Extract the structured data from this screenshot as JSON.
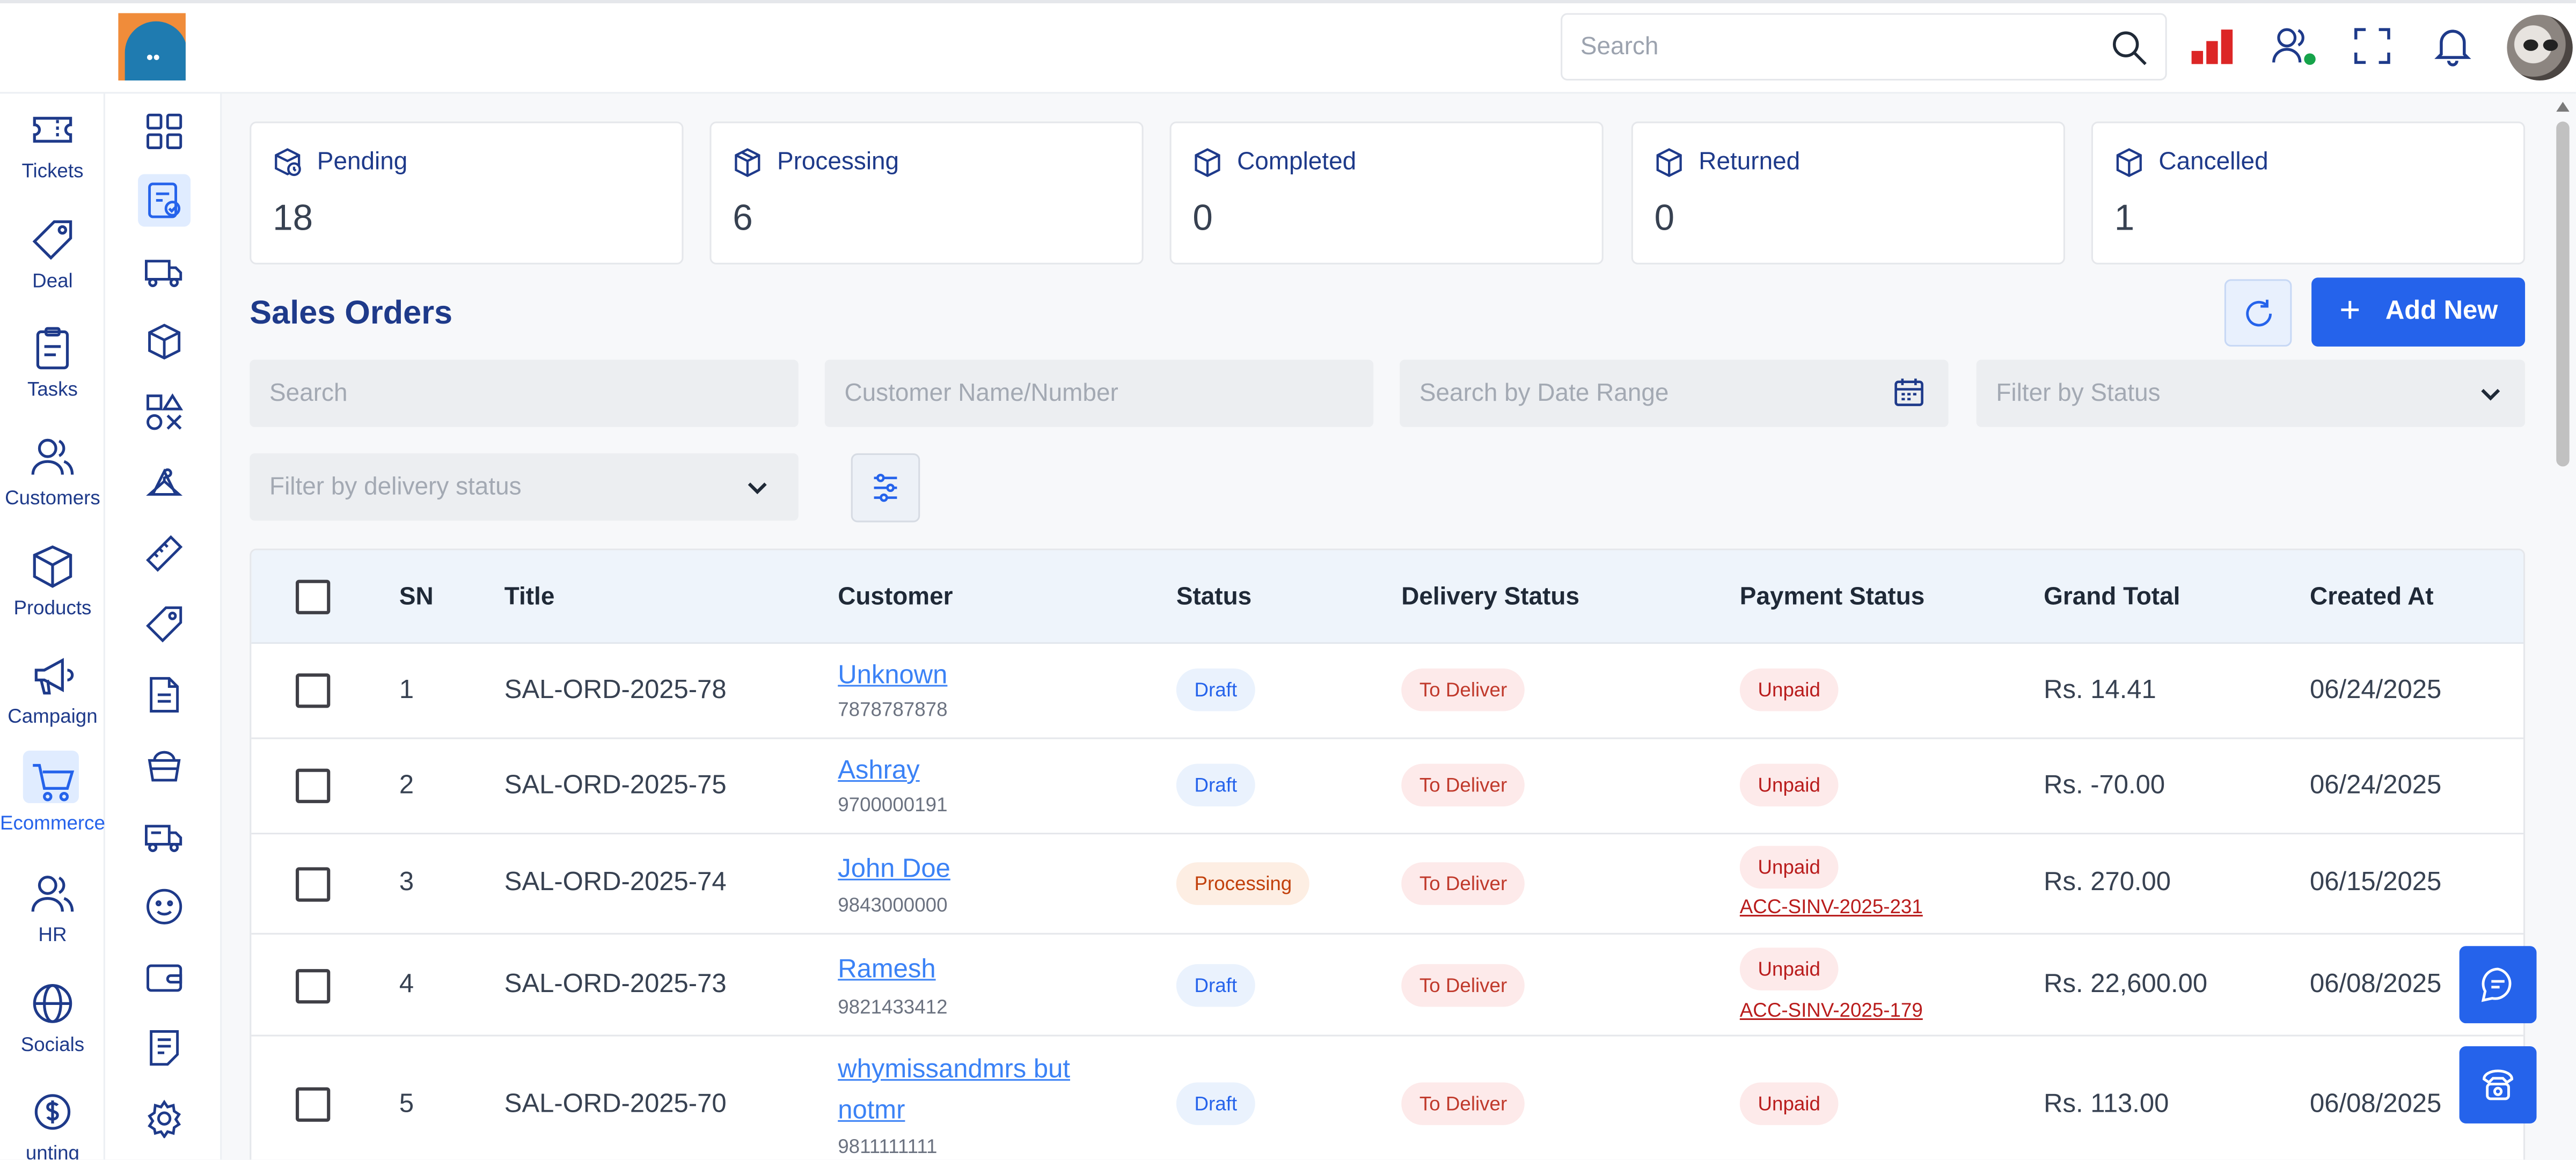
{
  "topbar": {
    "search_placeholder": "Search"
  },
  "sidebar": {
    "items": [
      {
        "label": "Tickets",
        "icon": "ticket-icon"
      },
      {
        "label": "Deal",
        "icon": "tag-icon"
      },
      {
        "label": "Tasks",
        "icon": "clipboard-icon"
      },
      {
        "label": "Customers",
        "icon": "users-icon"
      },
      {
        "label": "Products",
        "icon": "box-icon"
      },
      {
        "label": "Campaign",
        "icon": "megaphone-icon"
      },
      {
        "label": "Ecommerce",
        "icon": "cart-icon",
        "active": true
      },
      {
        "label": "HR",
        "icon": "people-icon"
      },
      {
        "label": "Socials",
        "icon": "globe-icon"
      },
      {
        "label": "unting",
        "icon": "dollar-icon"
      }
    ]
  },
  "subbar": {
    "icons": [
      "dashboard-grid-icon",
      "order-check-icon",
      "truck-icon",
      "cube-icon",
      "shapes-icon",
      "hanger-icon",
      "ruler-icon",
      "tag-icon",
      "document-icon",
      "basket-icon",
      "delivery-truck-icon",
      "smiley-icon",
      "wallet-icon",
      "note-icon",
      "settings-gear-icon"
    ],
    "active_index": 1
  },
  "stats": [
    {
      "label": "Pending",
      "value": "18"
    },
    {
      "label": "Processing",
      "value": "6"
    },
    {
      "label": "Completed",
      "value": "0"
    },
    {
      "label": "Returned",
      "value": "0"
    },
    {
      "label": "Cancelled",
      "value": "1"
    }
  ],
  "section": {
    "title": "Sales Orders",
    "add_label": "Add New"
  },
  "filters": {
    "search_placeholder": "Search",
    "customer_placeholder": "Customer Name/Number",
    "date_placeholder": "Search by Date Range",
    "status_placeholder": "Filter by Status",
    "delivery_placeholder": "Filter by delivery status"
  },
  "table": {
    "columns": [
      "SN",
      "Title",
      "Customer",
      "Status",
      "Delivery Status",
      "Payment Status",
      "Grand Total",
      "Created At"
    ],
    "rows": [
      {
        "sn": "1",
        "title": "SAL-ORD-2025-78",
        "customer": "Unknown",
        "phone": "7878787878",
        "status": "Draft",
        "delivery": "To Deliver",
        "payment": "Unpaid",
        "invoice": "",
        "total": "Rs. 14.41",
        "created": "06/24/2025"
      },
      {
        "sn": "2",
        "title": "SAL-ORD-2025-75",
        "customer": "Ashray",
        "phone": "9700000191",
        "status": "Draft",
        "delivery": "To Deliver",
        "payment": "Unpaid",
        "invoice": "",
        "total": "Rs. -70.00",
        "created": "06/24/2025"
      },
      {
        "sn": "3",
        "title": "SAL-ORD-2025-74",
        "customer": "John Doe",
        "phone": "9843000000",
        "status": "Processing",
        "delivery": "To Deliver",
        "payment": "Unpaid",
        "invoice": "ACC-SINV-2025-231",
        "total": "Rs. 270.00",
        "created": "06/15/2025"
      },
      {
        "sn": "4",
        "title": "SAL-ORD-2025-73",
        "customer": "Ramesh",
        "phone": "9821433412",
        "status": "Draft",
        "delivery": "To Deliver",
        "payment": "Unpaid",
        "invoice": "ACC-SINV-2025-179",
        "total": "Rs. 22,600.00",
        "created": "06/08/2025"
      },
      {
        "sn": "5",
        "title": "SAL-ORD-2025-70",
        "customer_line1": "whymissandmrs but",
        "customer_line2": "notmr",
        "phone": "9811111111",
        "status": "Draft",
        "delivery": "To Deliver",
        "payment": "Unpaid",
        "invoice": "",
        "total": "Rs. 113.00",
        "created": "06/08/2025"
      }
    ]
  },
  "colors": {
    "accent": "#2563eb",
    "heading": "#1e3a8a",
    "danger": "#b91c1c"
  }
}
